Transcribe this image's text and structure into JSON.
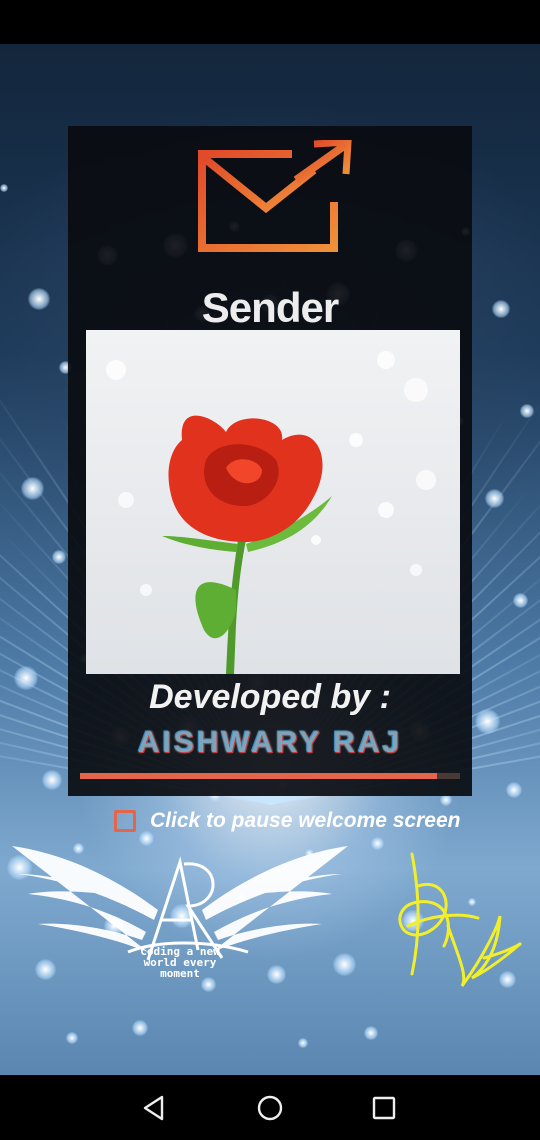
{
  "app": {
    "title": "Sender",
    "developed_label": "Developed by :",
    "developer_name": "AISHWARY RAJ",
    "pause_label": "Click to pause welcome screen",
    "pause_checked": false,
    "progress_fraction": 0.94,
    "emblem_letters": "AR",
    "emblem_tagline_1": "Coding a new",
    "emblem_tagline_2": "world every",
    "emblem_tagline_3": "moment"
  },
  "colors": {
    "accent": "#e4654a",
    "card_bg": "#0a0c10",
    "signature": "#f2ef2a"
  },
  "icons": {
    "logo": "mail-send-icon",
    "nav_back": "back-triangle-icon",
    "nav_home": "home-circle-icon",
    "nav_recents": "recents-square-icon"
  }
}
